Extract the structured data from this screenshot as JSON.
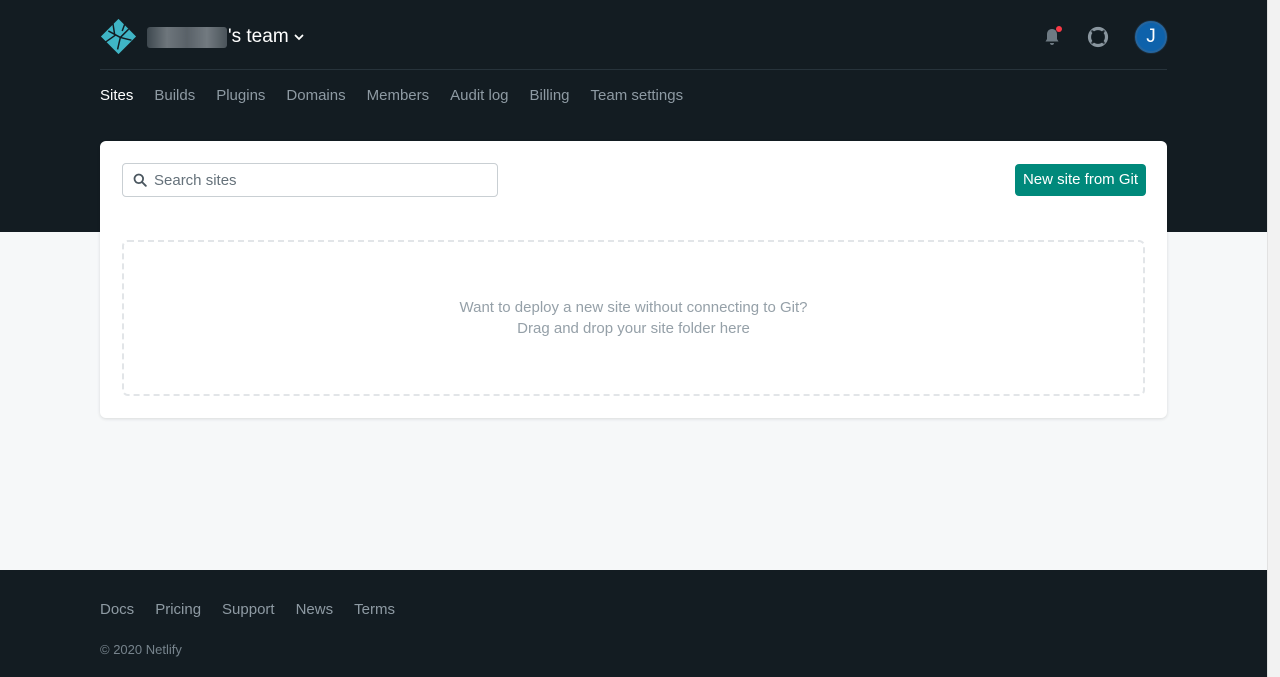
{
  "header": {
    "team_suffix": "'s team",
    "notification_count_indicator": true
  },
  "avatar": {
    "initial": "J"
  },
  "nav": {
    "items": [
      "Sites",
      "Builds",
      "Plugins",
      "Domains",
      "Members",
      "Audit log",
      "Billing",
      "Team settings"
    ],
    "active": "Sites"
  },
  "search": {
    "placeholder": "Search sites"
  },
  "actions": {
    "new_site_label": "New site from Git"
  },
  "dropzone": {
    "line1": "Want to deploy a new site without connecting to Git?",
    "line2": "Drag and drop your site folder here"
  },
  "footer": {
    "links": [
      "Docs",
      "Pricing",
      "Support",
      "News",
      "Terms"
    ],
    "copyright": "© 2020 Netlify"
  },
  "colors": {
    "header_bg": "#131c22",
    "accent": "#00897b",
    "notification_dot": "#fa3946",
    "avatar_bg": "#0e62ab",
    "logo": "#3fb5c6"
  },
  "icons": [
    "netlify-logo-icon",
    "chevron-down-icon",
    "bell-icon",
    "lifebuoy-icon",
    "search-icon"
  ]
}
